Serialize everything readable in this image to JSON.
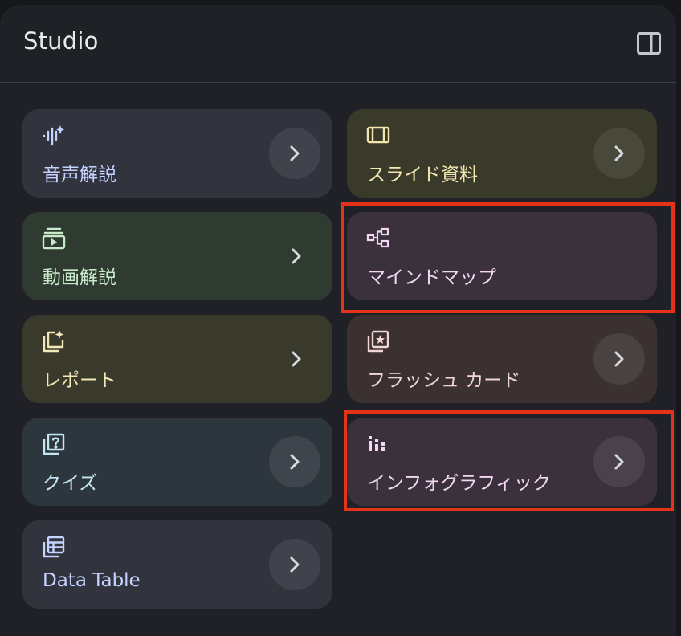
{
  "header": {
    "title": "Studio"
  },
  "cards": [
    {
      "label": "音声解説",
      "icon": "audio-sparkle-icon",
      "bg": "#31343d",
      "text_color": "#c6d2ff",
      "chevron": "circle"
    },
    {
      "label": "スライド資料",
      "icon": "slides-icon",
      "bg": "#3a3a2b",
      "text_color": "#f2e7b0",
      "chevron": "circle"
    },
    {
      "label": "動画解説",
      "icon": "video-stack-icon",
      "bg": "#2f3a30",
      "text_color": "#c8eacb",
      "chevron": "plain"
    },
    {
      "label": "マインドマップ",
      "icon": "mind-map-icon",
      "bg": "#3b313c",
      "text_color": "#f2d6f2",
      "chevron": "none"
    },
    {
      "label": "レポート",
      "icon": "report-sparkle-icon",
      "bg": "#3a3a2c",
      "text_color": "#f2e8b6",
      "chevron": "plain"
    },
    {
      "label": "フラッシュ カード",
      "icon": "flashcards-icon",
      "bg": "#3b3131",
      "text_color": "#f3d6d6",
      "chevron": "circle"
    },
    {
      "label": "クイズ",
      "icon": "quiz-icon",
      "bg": "#2e363d",
      "text_color": "#c3e7f2",
      "chevron": "circle"
    },
    {
      "label": "インフォグラフィック",
      "icon": "infographic-icon",
      "bg": "#3b313c",
      "text_color": "#f2d6f2",
      "chevron": "circle"
    },
    {
      "label": "Data Table",
      "icon": "data-table-icon",
      "bg": "#31343d",
      "text_color": "#c6d2ff",
      "chevron": "circle"
    }
  ],
  "colors": {
    "highlight": "#e5321b",
    "panel_bg": "#1f2127",
    "page_bg": "#15171a"
  }
}
